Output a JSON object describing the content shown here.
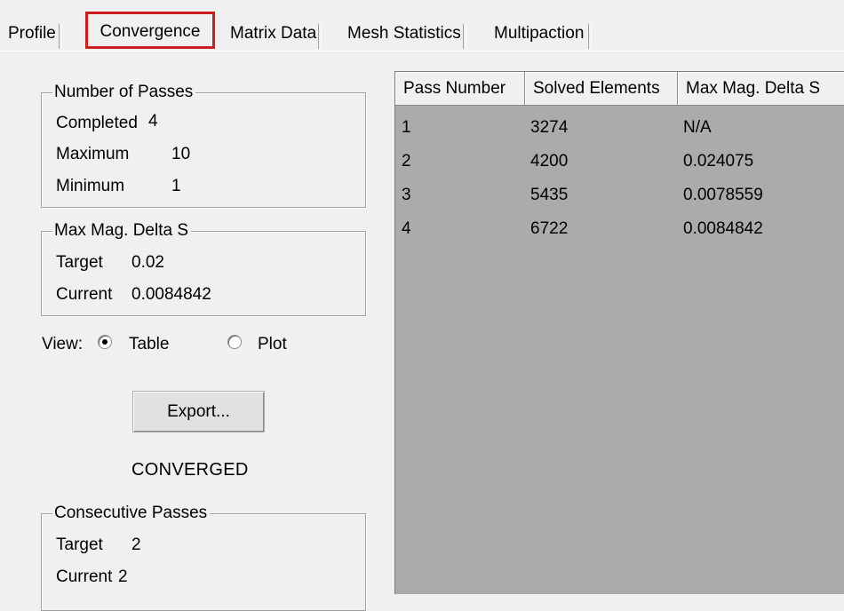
{
  "tabs": {
    "profile": "Profile",
    "convergence": "Convergence",
    "matrix_data": "Matrix Data",
    "mesh_statistics": "Mesh Statistics",
    "multipaction": "Multipaction",
    "active": "Convergence",
    "highlight_color": "#cc1f1f"
  },
  "passes": {
    "legend": "Number of Passes",
    "completed_label": "Completed",
    "completed_value": "4",
    "maximum_label": "Maximum",
    "maximum_value": "10",
    "minimum_label": "Minimum",
    "minimum_value": "1"
  },
  "delta": {
    "legend": "Max Mag. Delta S",
    "target_label": "Target",
    "target_value": "0.02",
    "current_label": "Current",
    "current_value": "0.0084842"
  },
  "view": {
    "label": "View:",
    "option_table": "Table",
    "option_plot": "Plot",
    "selected": "Table"
  },
  "export_button": "Export...",
  "status": "CONVERGED",
  "consecutive": {
    "legend": "Consecutive Passes",
    "target_label": "Target",
    "target_value": "2",
    "current_label": "Current",
    "current_value": "2"
  },
  "table": {
    "columns": [
      "Pass Number",
      "Solved Elements",
      "Max Mag. Delta S"
    ],
    "rows": [
      [
        "1",
        "3274",
        "N/A"
      ],
      [
        "2",
        "4200",
        "0.024075"
      ],
      [
        "3",
        "5435",
        "0.0078559"
      ],
      [
        "4",
        "6722",
        "0.0084842"
      ]
    ]
  }
}
